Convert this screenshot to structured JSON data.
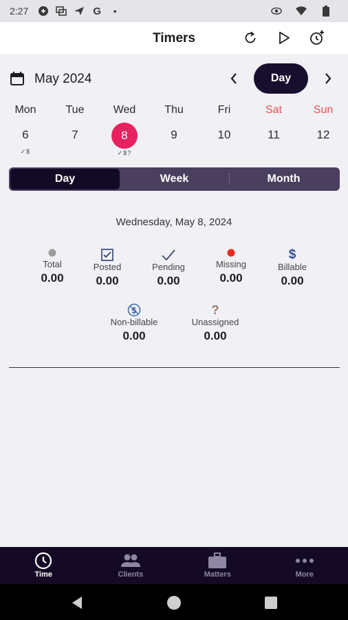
{
  "status_bar": {
    "time": "2:27",
    "dot": "•"
  },
  "app_bar": {
    "title": "Timers"
  },
  "calendar": {
    "month_label": "May 2024",
    "view_pill": "Day",
    "days": [
      {
        "name": "Mon",
        "num": "6",
        "marks": "✓$",
        "weekend": false,
        "selected": false
      },
      {
        "name": "Tue",
        "num": "7",
        "marks": "",
        "weekend": false,
        "selected": false
      },
      {
        "name": "Wed",
        "num": "8",
        "marks": "✓$?",
        "weekend": false,
        "selected": true
      },
      {
        "name": "Thu",
        "num": "9",
        "marks": "",
        "weekend": false,
        "selected": false
      },
      {
        "name": "Fri",
        "num": "10",
        "marks": "",
        "weekend": false,
        "selected": false
      },
      {
        "name": "Sat",
        "num": "11",
        "marks": "",
        "weekend": true,
        "selected": false
      },
      {
        "name": "Sun",
        "num": "12",
        "marks": "",
        "weekend": true,
        "selected": false
      }
    ]
  },
  "segmented": {
    "day": "Day",
    "week": "Week",
    "month": "Month",
    "active": "Day"
  },
  "summary": {
    "date_heading": "Wednesday, May 8, 2024",
    "total": {
      "label": "Total",
      "value": "0.00"
    },
    "posted": {
      "label": "Posted",
      "value": "0.00"
    },
    "pending": {
      "label": "Pending",
      "value": "0.00"
    },
    "missing": {
      "label": "Missing",
      "value": "0.00"
    },
    "billable": {
      "label": "Billable",
      "value": "0.00"
    },
    "non_billable": {
      "label": "Non-billable",
      "value": "0.00"
    },
    "unassigned": {
      "label": "Unassigned",
      "value": "0.00"
    }
  },
  "bottom_nav": {
    "time": "Time",
    "clients": "Clients",
    "matters": "Matters",
    "more": "More"
  },
  "colors": {
    "accent": "#e8215f",
    "nav_bg": "#150a26",
    "weekend": "#e5524f",
    "missing": "#e8291c",
    "billable": "#2f4f8f",
    "unassigned": "#9c7a6a"
  }
}
